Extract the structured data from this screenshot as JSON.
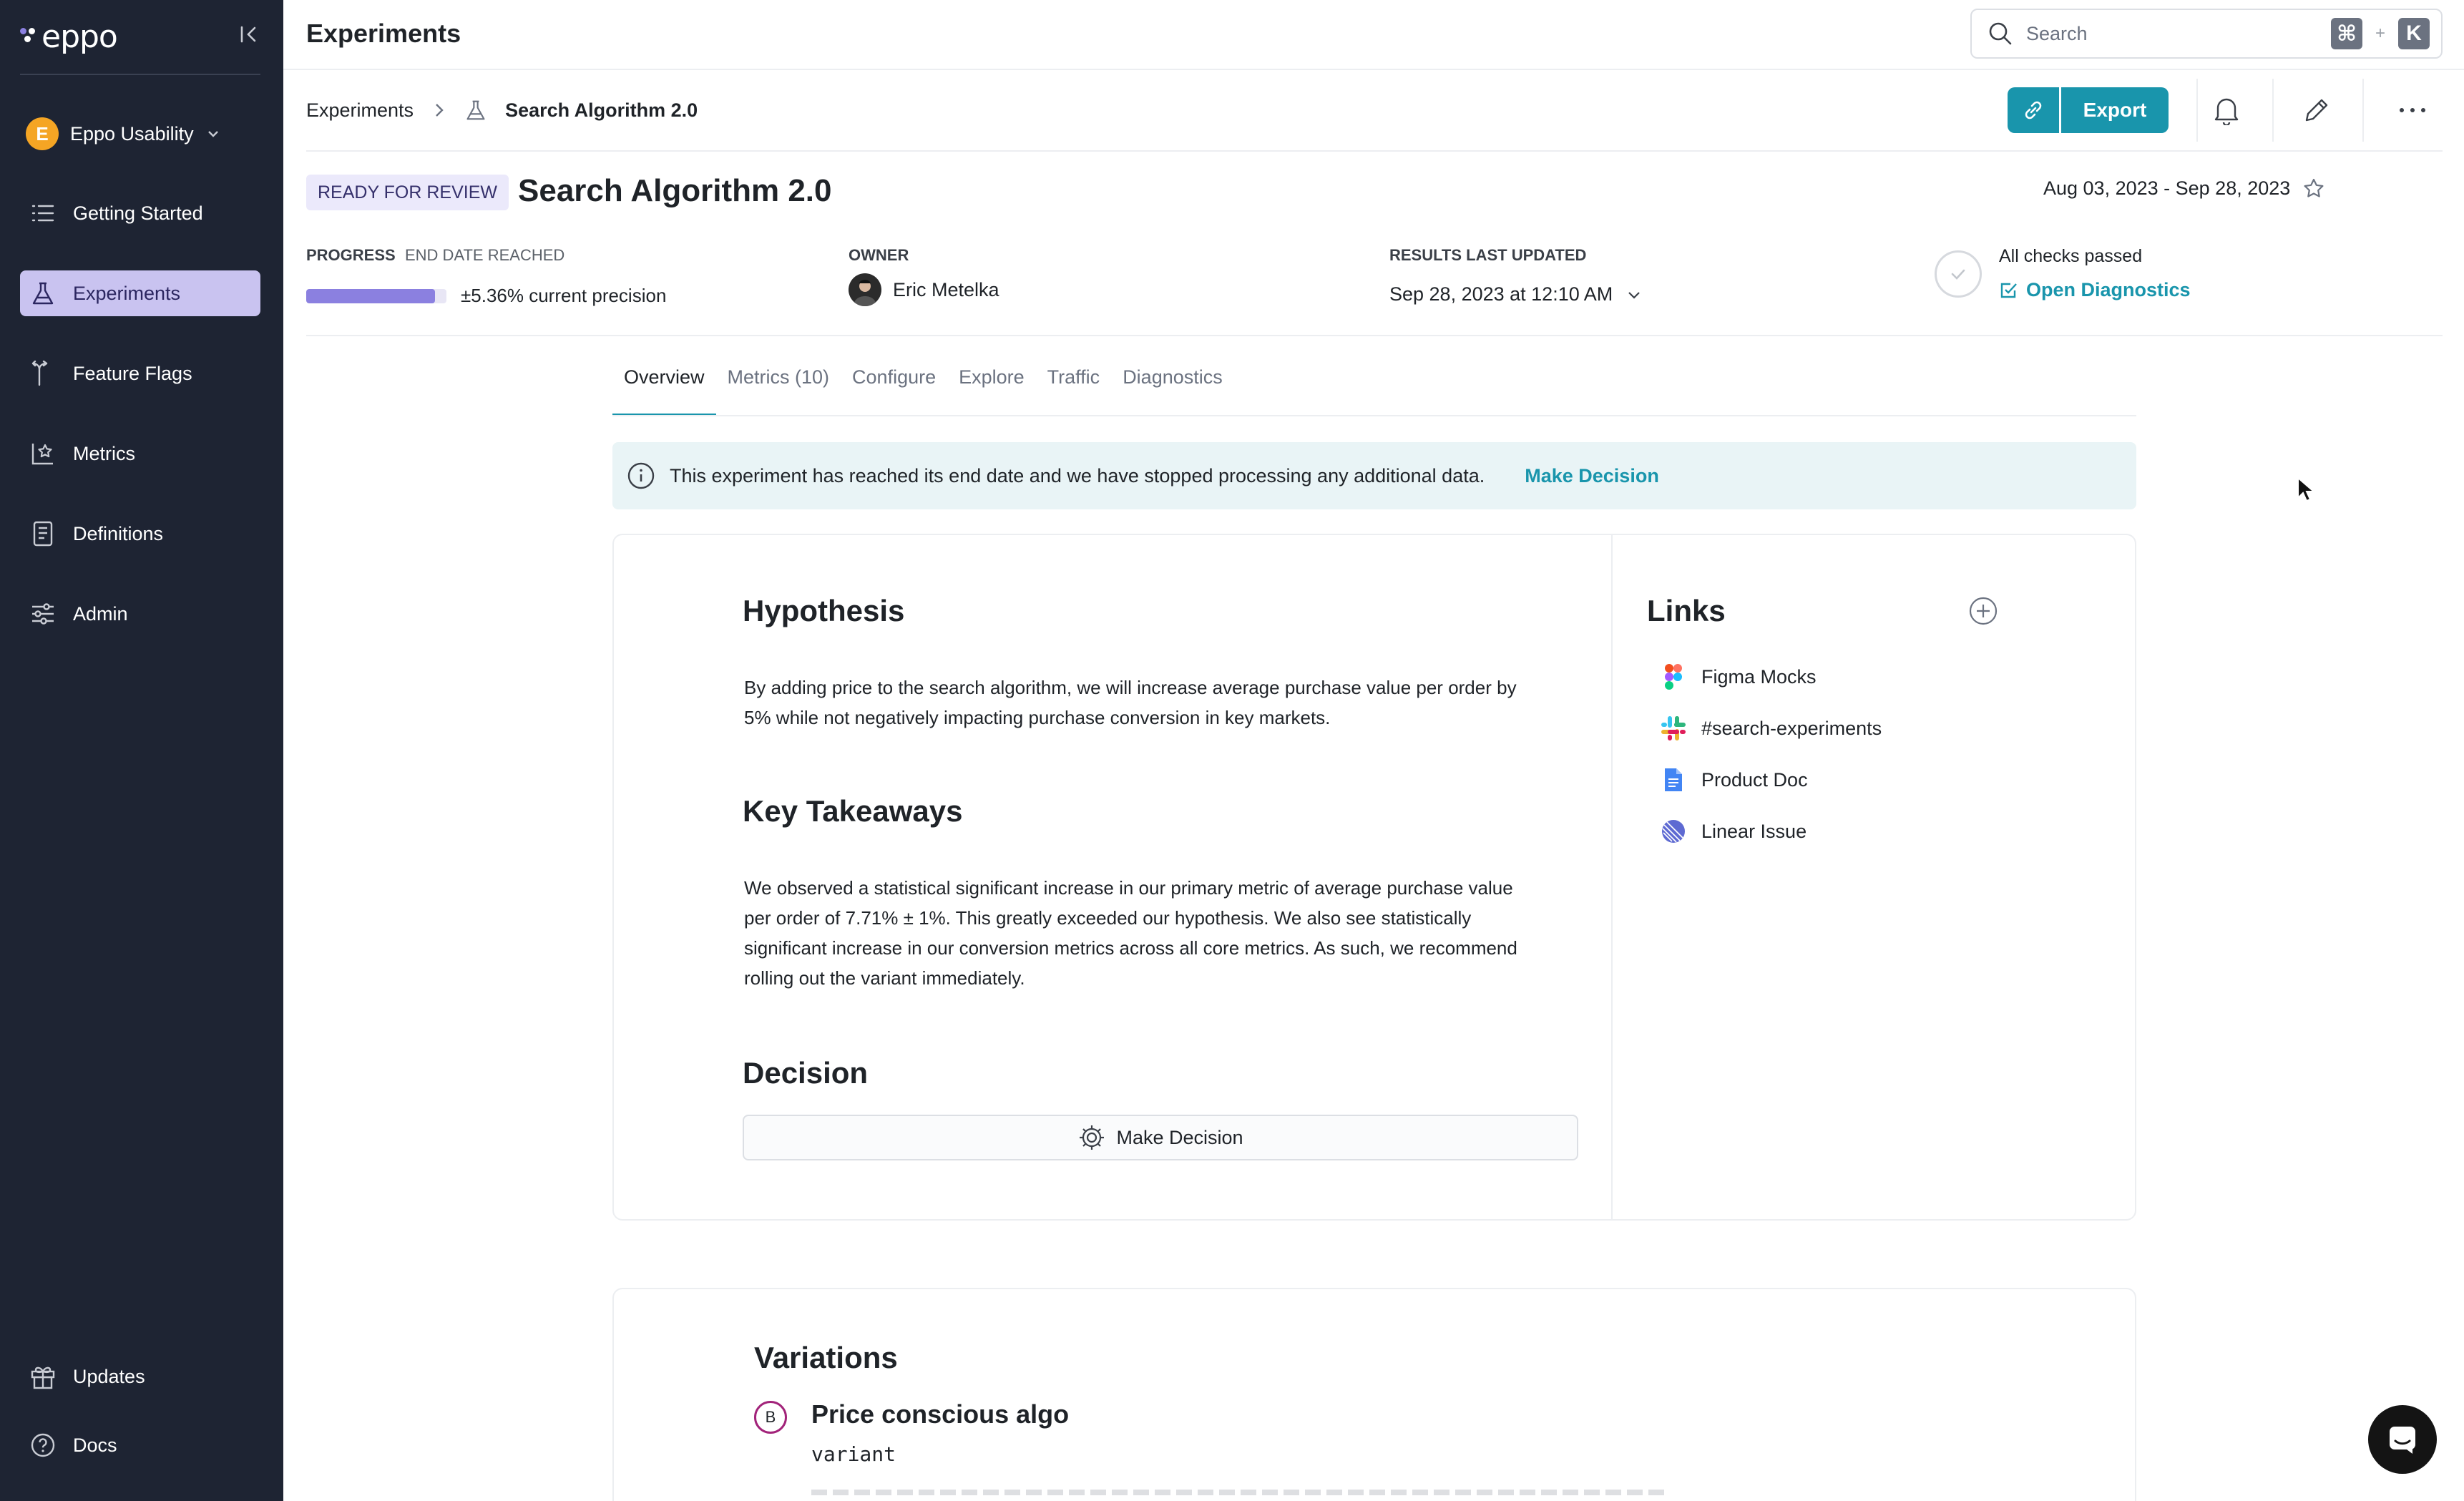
{
  "sidebar": {
    "logo": "eppo",
    "workspace": {
      "initial": "E",
      "name": "Eppo Usability"
    },
    "items": [
      {
        "label": "Getting Started",
        "icon": "list-icon"
      },
      {
        "label": "Experiments",
        "icon": "flask-icon",
        "active": true
      },
      {
        "label": "Feature Flags",
        "icon": "flag-branch-icon"
      },
      {
        "label": "Metrics",
        "icon": "chart-star-icon"
      },
      {
        "label": "Definitions",
        "icon": "book-icon"
      },
      {
        "label": "Admin",
        "icon": "sliders-icon"
      }
    ],
    "bottom_items": [
      {
        "label": "Updates",
        "icon": "gift-icon"
      },
      {
        "label": "Docs",
        "icon": "help-circle-icon"
      }
    ]
  },
  "header": {
    "title": "Experiments",
    "search": {
      "placeholder": "Search",
      "shortcut_key1": "⌘",
      "shortcut_plus": "+",
      "shortcut_key2": "K"
    }
  },
  "breadcrumb": {
    "parent": "Experiments",
    "current": "Search Algorithm 2.0"
  },
  "toolbar": {
    "export_label": "Export"
  },
  "experiment": {
    "status": "READY FOR REVIEW",
    "title": "Search Algorithm 2.0",
    "date_range": "Aug 03, 2023 - Sep 28, 2023",
    "progress_label": "PROGRESS",
    "progress_sub": "END DATE REACHED",
    "progress_fraction": 0.92,
    "precision": "±5.36% current precision",
    "owner_label": "OWNER",
    "owner_name": "Eric Metelka",
    "results_label": "RESULTS LAST UPDATED",
    "results_value": "Sep 28, 2023 at 12:10 AM",
    "checks_text": "All checks passed",
    "diagnostics_link": "Open Diagnostics"
  },
  "tabs": [
    {
      "label": "Overview",
      "active": true
    },
    {
      "label": "Metrics (10)"
    },
    {
      "label": "Configure"
    },
    {
      "label": "Explore"
    },
    {
      "label": "Traffic"
    },
    {
      "label": "Diagnostics"
    }
  ],
  "banner": {
    "text": "This experiment has reached its end date and we have stopped processing any additional data.",
    "action": "Make Decision"
  },
  "overview": {
    "hypothesis_title": "Hypothesis",
    "hypothesis_line1": "By adding price to the search algorithm, we will increase average purchase value per order by",
    "hypothesis_line2": "5% while not negatively impacting purchase conversion in key markets.",
    "takeaways_title": "Key Takeaways",
    "takeaways_line1": "We observed a statistical significant increase in our primary metric of average purchase value",
    "takeaways_line2": "per order of 7.71% ± 1%. This greatly exceeded our hypothesis. We also see statistically",
    "takeaways_line3": "significant increase in our conversion metrics across all core metrics. As such, we recommend",
    "takeaways_line4": "rolling out the variant immediately.",
    "decision_title": "Decision",
    "decision_button": "Make Decision"
  },
  "links": {
    "title": "Links",
    "items": [
      {
        "label": "Figma Mocks",
        "icon": "figma-icon"
      },
      {
        "label": "#search-experiments",
        "icon": "slack-icon"
      },
      {
        "label": "Product Doc",
        "icon": "google-doc-icon"
      },
      {
        "label": "Linear Issue",
        "icon": "linear-icon"
      }
    ]
  },
  "variations": {
    "title": "Variations",
    "items": [
      {
        "badge": "B",
        "name": "Price conscious algo",
        "key": "variant"
      }
    ]
  },
  "colors": {
    "accent": "#1995ac",
    "sidebar_bg": "#1e2433",
    "active_nav": "#c9c3f0",
    "progress": "#8b80e0"
  }
}
